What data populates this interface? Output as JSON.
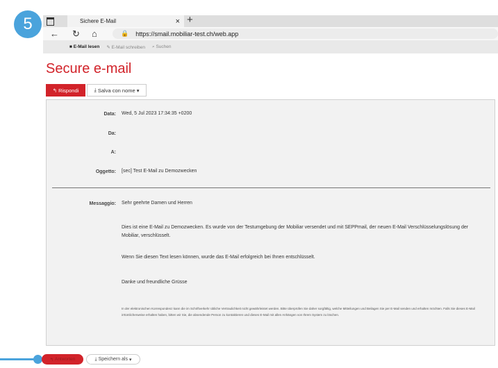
{
  "step": {
    "number": "5"
  },
  "browser": {
    "tab_title": "Sichere E-Mail",
    "tab_close": "×",
    "new_tab": "+",
    "url": "https://smail.mobiliar-test.ch/web.app"
  },
  "appnav": {
    "items": [
      {
        "label": "E-Mail lesen",
        "icon": "book-icon"
      },
      {
        "label": "E-Mail schreiben",
        "icon": "pencil-icon"
      },
      {
        "label": "Suchen",
        "icon": "search-icon"
      }
    ]
  },
  "page": {
    "title": "Secure e-mail"
  },
  "toolbar": {
    "reply_label": "Rispondi",
    "save_label": "Salva con nome"
  },
  "email": {
    "date_label": "Data:",
    "date_value": "Wed, 5 Jul 2023 17:34:35 +0200",
    "from_label": "Da:",
    "to_label": "A:",
    "subject_label": "Oggetto:",
    "subject_value": "[sec] Test E-Mail zu Demozwecken",
    "message_label": "Messaggio:",
    "body": {
      "p1": "Sehr geehrte Damen und Herren",
      "p2": "Dies ist eine E-Mail zu Demozwecken. Es wurde von der Testumgebung der Mobiliar versendet und mit SEPPmail, der neuen E-Mail Verschlüsselungslösung der Mobiliar, verschlüsselt.",
      "p3": "Wenn Sie diesen Text lesen können, wurde das E-Mail erfolgreich bei Ihnen entschlüsselt.",
      "p4": "Danke und freundliche Grüsse",
      "disclaimer": "In der elektronischen Korrespondenz kann die im Schriftverkehr übliche Vertraulichkeit nicht gewährleistet werden. Bitte überprüfen Sie daher sorgfältig, welche Mitteilungen und Beilagen Sie per E-Mail senden und erhalten möchten. Falls Sie dieses E-Mail irrtümlicherweise erhalten haben, bitten wir Sie, die absendende Person zu kontaktieren und dieses E-Mail mit allen Anhängen von Ihrem System zu löschen."
    }
  },
  "bottom": {
    "reply_label": "Antworten",
    "save_label": "Speichern als"
  }
}
